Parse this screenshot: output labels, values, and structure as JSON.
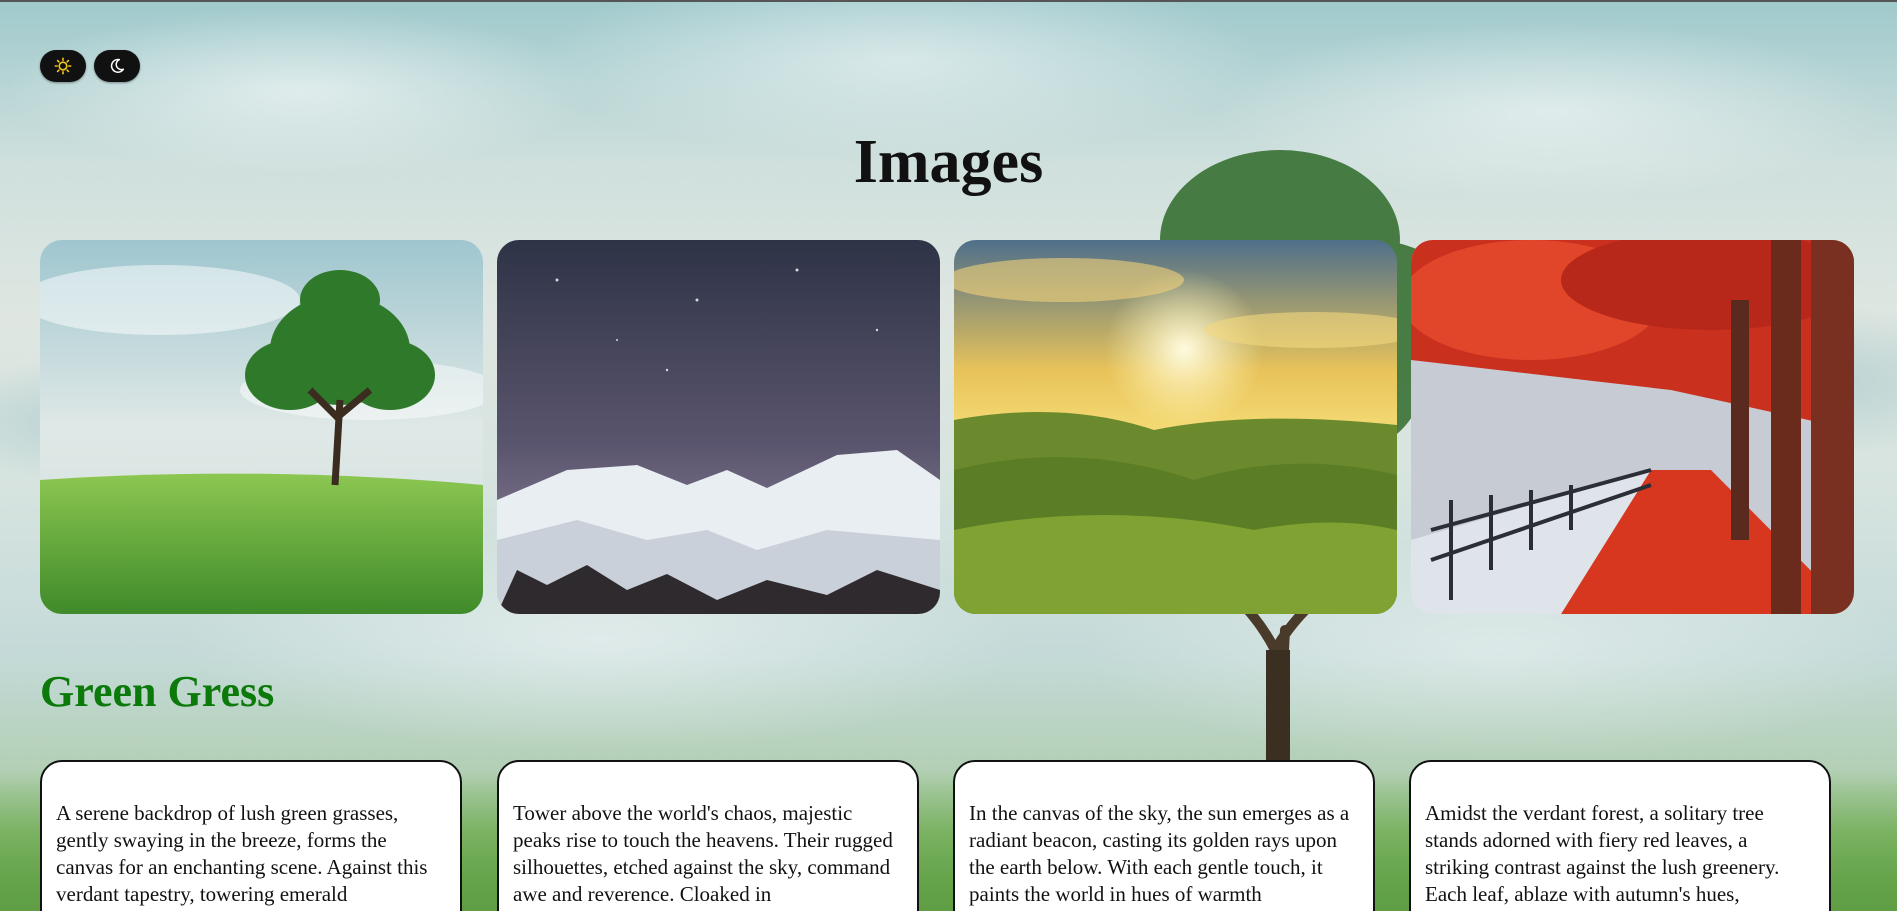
{
  "theme": {
    "light_icon": "sun-icon",
    "dark_icon": "moon-icon"
  },
  "page": {
    "title": "Images"
  },
  "gallery": [
    {
      "name": "green-grass-tree-image",
      "icon": "tree-field-image"
    },
    {
      "name": "snowy-mountain-night-image",
      "icon": "mountain-image"
    },
    {
      "name": "sunset-hills-image",
      "icon": "sunset-image"
    },
    {
      "name": "red-autumn-trees-image",
      "icon": "autumn-path-image"
    }
  ],
  "section": {
    "title": "Green Gress",
    "title_color": "#0b7a0b"
  },
  "descriptions": [
    {
      "text": "A serene backdrop of lush green grasses, gently swaying in the breeze, forms the canvas for an enchanting scene. Against this verdant tapestry, towering emerald"
    },
    {
      "text": "Tower above the world's chaos, majestic peaks rise to touch the heavens. Their rugged silhouettes, etched against the sky, command awe and reverence. Cloaked in"
    },
    {
      "text": "In the canvas of the sky, the sun emerges as a radiant beacon, casting its golden rays upon the earth below. With each gentle touch, it paints the world in hues of warmth"
    },
    {
      "text": "Amidst the verdant forest, a solitary tree stands adorned with fiery red leaves, a striking contrast against the lush greenery. Each leaf, ablaze with autumn's hues,"
    }
  ]
}
